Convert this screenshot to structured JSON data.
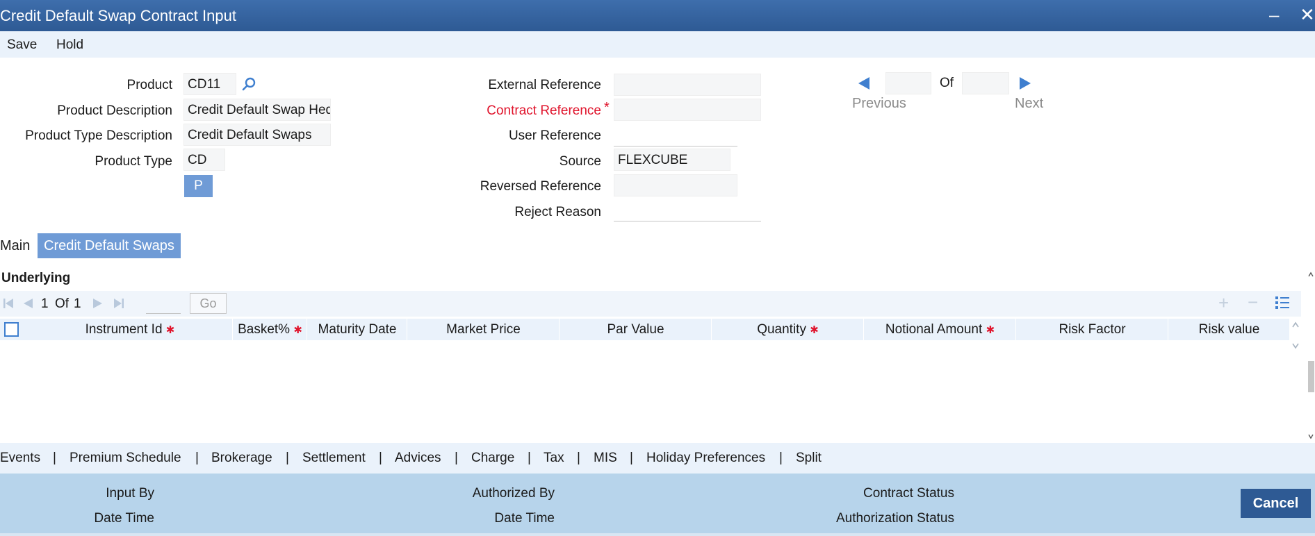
{
  "window": {
    "title": "Credit Default Swap Contract Input",
    "minimize": "–",
    "close": "✕"
  },
  "menu": {
    "save": "Save",
    "hold": "Hold"
  },
  "form": {
    "product_label": "Product",
    "product_value": "CD11",
    "product_desc_label": "Product Description",
    "product_desc_value": "Credit Default Swap Hedging",
    "product_type_desc_label": "Product Type Description",
    "product_type_desc_value": "Credit Default Swaps",
    "product_type_label": "Product Type",
    "product_type_value": "CD",
    "p_button": "P",
    "external_ref_label": "External Reference",
    "external_ref_value": "",
    "contract_ref_label": "Contract Reference",
    "contract_ref_value": "",
    "user_ref_label": "User Reference",
    "user_ref_value": "",
    "source_label": "Source",
    "source_value": "FLEXCUBE",
    "reversed_ref_label": "Reversed Reference",
    "reversed_ref_value": "",
    "reject_reason_label": "Reject Reason",
    "reject_reason_value": ""
  },
  "record_nav": {
    "current": "",
    "of_label": "Of",
    "total": "",
    "previous": "Previous",
    "next": "Next"
  },
  "tabs": {
    "main": "Main",
    "cds": "Credit Default Swaps"
  },
  "underlying": {
    "title": "Underlying",
    "pager": {
      "page": "1",
      "of_label": "Of",
      "total": "1",
      "go": "Go"
    },
    "columns": [
      "Instrument Id",
      "Basket%",
      "Maturity Date",
      "Market Price",
      "Par Value",
      "Quantity",
      "Notional Amount",
      "Risk Factor",
      "Risk value"
    ],
    "required_columns": [
      true,
      true,
      false,
      false,
      false,
      true,
      true,
      false,
      false
    ]
  },
  "links": [
    "Events",
    "Premium Schedule",
    "Brokerage",
    "Settlement",
    "Advices",
    "Charge",
    "Tax",
    "MIS",
    "Holiday Preferences",
    "Split"
  ],
  "link_separator": "|",
  "footer": {
    "input_by": "Input By",
    "date_time_1": "Date Time",
    "authorized_by": "Authorized By",
    "date_time_2": "Date Time",
    "contract_status": "Contract Status",
    "authorization_status": "Authorization Status",
    "cancel": "Cancel"
  },
  "colors": {
    "title_bar": "#2e5a94",
    "accent": "#6f9bd6",
    "required": "#e0142c",
    "footer": "#b7d4eb"
  },
  "icons": {
    "search": "search-icon",
    "prev": "triangle-left-icon",
    "next": "triangle-right-icon"
  }
}
